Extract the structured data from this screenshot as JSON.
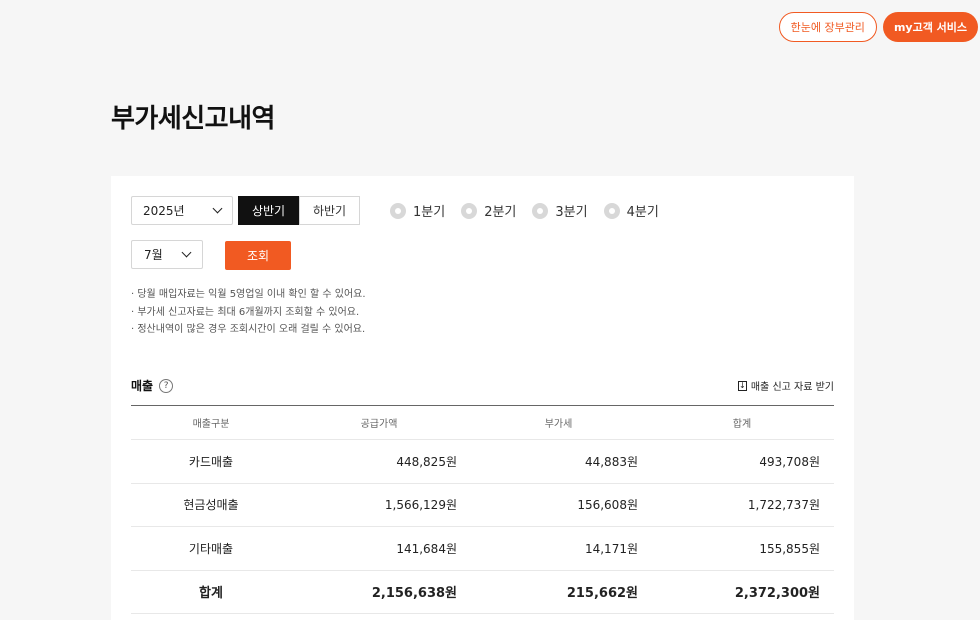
{
  "header": {
    "ledger_button": "한눈에 장부관리",
    "my_service_button": "my고객 서비스"
  },
  "page_title": "부가세신고내역",
  "filters": {
    "year": "2025년",
    "half_options": [
      "상반기",
      "하반기"
    ],
    "half_selected": "상반기",
    "quarters": [
      "1분기",
      "2분기",
      "3분기",
      "4분기"
    ],
    "month": "7월",
    "search_label": "조회"
  },
  "notes": [
    "· 당월 매입자료는 익월 5영업일 이내 확인 할 수 있어요.",
    "· 부가세 신고자료는 최대 6개월까지 조회할 수 있어요.",
    "· 정산내역이 많은 경우 조회시간이 오래 걸릴 수 있어요."
  ],
  "sales": {
    "title": "매출",
    "help_icon": "?",
    "download_label": "매출 신고 자료 받기",
    "columns": [
      "매출구분",
      "공급가액",
      "부가세",
      "합계"
    ],
    "rows": [
      [
        "카드매출",
        "448,825원",
        "44,883원",
        "493,708원"
      ],
      [
        "현금성매출",
        "1,566,129원",
        "156,608원",
        "1,722,737원"
      ],
      [
        "기타매출",
        "141,684원",
        "14,171원",
        "155,855원"
      ],
      [
        "합계",
        "2,156,638원",
        "215,662원",
        "2,372,300원"
      ]
    ]
  },
  "colors": {
    "accent": "#f15a22",
    "selected_tab": "#111111"
  }
}
